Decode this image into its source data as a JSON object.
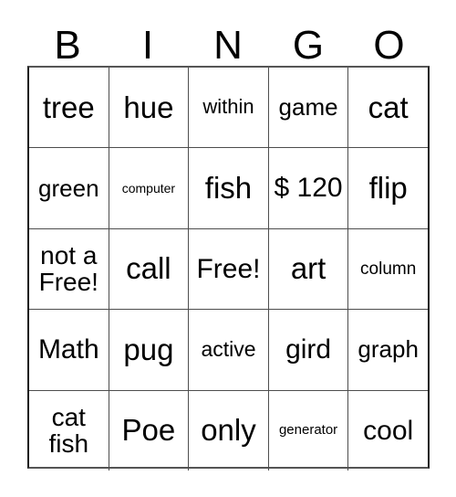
{
  "card": {
    "headers": [
      "B",
      "I",
      "N",
      "G",
      "O"
    ],
    "rows": [
      [
        {
          "text": "tree",
          "size": "fs-xl"
        },
        {
          "text": "hue",
          "size": "fs-xl"
        },
        {
          "text": "within",
          "size": "fs-sm2"
        },
        {
          "text": "game",
          "size": "fs-md"
        },
        {
          "text": "cat",
          "size": "fs-xl"
        }
      ],
      [
        {
          "text": "green",
          "size": "fs-md"
        },
        {
          "text": "computer",
          "size": "fs-xxs2"
        },
        {
          "text": "fish",
          "size": "fs-xl"
        },
        {
          "text": "$ 120",
          "size": "fs-lg"
        },
        {
          "text": "flip",
          "size": "fs-xl"
        }
      ],
      [
        {
          "text": "not a Free!",
          "size": "fs-mdl"
        },
        {
          "text": "call",
          "size": "fs-xl"
        },
        {
          "text": "Free!",
          "size": "fs-lg"
        },
        {
          "text": "art",
          "size": "fs-xl"
        },
        {
          "text": "column",
          "size": "fs-xs"
        }
      ],
      [
        {
          "text": "Math",
          "size": "fs-lg"
        },
        {
          "text": "pug",
          "size": "fs-xl"
        },
        {
          "text": "active",
          "size": "fs-sm"
        },
        {
          "text": "gird",
          "size": "fs-lg"
        },
        {
          "text": "graph",
          "size": "fs-md"
        }
      ],
      [
        {
          "text": "cat fish",
          "size": "fs-mdl"
        },
        {
          "text": "Poe",
          "size": "fs-xl"
        },
        {
          "text": "only",
          "size": "fs-xl"
        },
        {
          "text": "generator",
          "size": "fs-xxs"
        },
        {
          "text": "cool",
          "size": "fs-lg"
        }
      ]
    ]
  },
  "colors": {
    "background": "#ffffff",
    "text": "#000000",
    "grid_line": "#4d4d4d",
    "outer_border": "#1a1a1a"
  }
}
